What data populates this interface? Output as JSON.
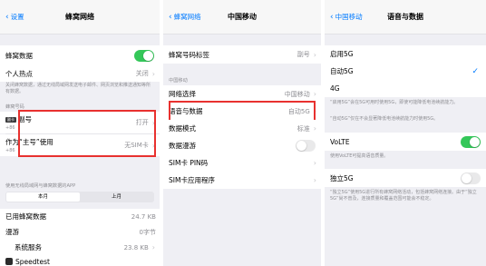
{
  "s1": {
    "back": "设置",
    "title": "蜂窝网络",
    "cellular_data": "蜂窝数据",
    "hotspot": {
      "label": "个人热点",
      "value": "关闭"
    },
    "hotspot_note": "关闭蜂窝数据，通过无线局域网发送电子邮件、网页浏览和推送通知等所有数据。",
    "section_plans": "蜂窝号码",
    "secondary": {
      "badge": "副卡",
      "label": "副号",
      "number": "+86",
      "value": "打开"
    },
    "primary": {
      "label": "作为“主号”使用",
      "number": "+86",
      "value": "无SIM卡"
    },
    "apps_header": "使用无线局域网与蜂窝数据的APP",
    "tabs": [
      "本月",
      "上月"
    ],
    "used": {
      "label": "已用蜂窝数据",
      "value": "24.7 KB"
    },
    "roaming": {
      "label": "漫游",
      "value": "0字节"
    },
    "system": {
      "label": "系统服务",
      "value": "23.8 KB"
    },
    "next_app": "Speedtest"
  },
  "s2": {
    "back": "蜂窝网络",
    "title": "中国移动",
    "label_row": {
      "label": "蜂窝号码标签",
      "value": "副号"
    },
    "section": "中国移动",
    "network": {
      "label": "网络选择",
      "value": "中国移动"
    },
    "voice_data": {
      "label": "语音与数据",
      "value": "自动5G"
    },
    "data_mode": {
      "label": "数据模式",
      "value": "标准"
    },
    "roaming": "数据漫游",
    "sim_pin": "SIM卡 PIN码",
    "sim_apps": "SIM卡应用程序"
  },
  "s3": {
    "back": "中国移动",
    "title": "语音与数据",
    "opt_5g_on": "启用5G",
    "opt_auto": "自动5G",
    "opt_4g": "4G",
    "note1": "“启用5G”会在5G可用时使用5G，即使可能降低电池续航能力。",
    "note2": "“自动5G”仅在不会显著降低电池续航能力时使用5G。",
    "volte": "VoLTE",
    "volte_note": "使用VoLTE可提高语音质量。",
    "sa": "独立5G",
    "sa_note": "“独立5G”使用5G进行所有蜂窝网络活动，包括蜂窝网络连接。由于“独立5G”尚不普及，连接质量和覆盖范围可能会不稳定。"
  },
  "colors": {
    "accent": "#007aff",
    "switch_on": "#34c759",
    "highlight": "#e8312f"
  }
}
